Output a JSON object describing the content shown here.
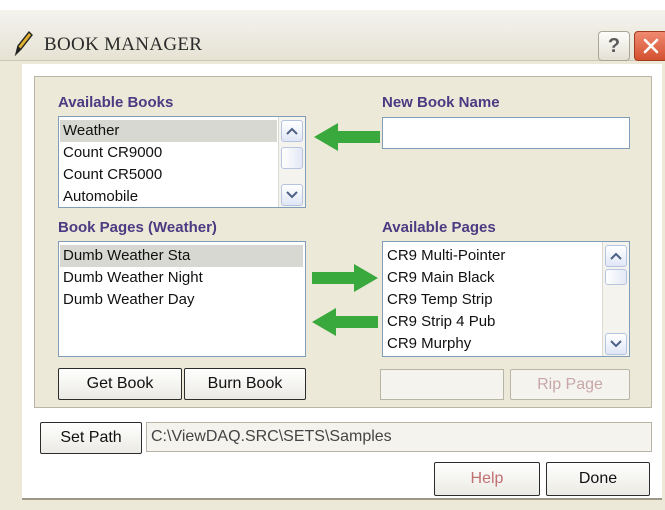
{
  "window": {
    "title": "BOOK MANAGER",
    "help_button": "?"
  },
  "available_books": {
    "label": "Available Books",
    "items": [
      "Weather",
      "Count CR9000",
      "Count CR5000",
      "Automobile"
    ],
    "selected": "Weather"
  },
  "new_book_name": {
    "label": "New Book Name",
    "value": ""
  },
  "book_pages": {
    "label": "Book Pages (Weather)",
    "items": [
      "Dumb Weather Sta",
      "Dumb Weather Night",
      "Dumb Weather Day"
    ],
    "selected": "Dumb Weather Sta"
  },
  "available_pages": {
    "label": "Available Pages",
    "items": [
      "CR9 Multi-Pointer",
      "CR9 Main Black",
      "CR9 Temp Strip",
      "CR9 Strip 4 Pub",
      "CR9 Murphy"
    ]
  },
  "buttons": {
    "get_book": "Get Book",
    "burn_book": "Burn Book",
    "rip_page": "Rip Page",
    "set_path": "Set Path",
    "help": "Help",
    "done": "Done"
  },
  "rip_page_input": {
    "value": ""
  },
  "path": {
    "value": "C:\\ViewDAQ.SRC\\SETS\\Samples"
  },
  "colors": {
    "label": "#4b3b82",
    "arrow": "#39a83d",
    "close": "#d4502f"
  },
  "icons": [
    "pencil-icon",
    "help-icon",
    "close-icon",
    "scroll-up-icon",
    "scroll-down-icon",
    "arrow-left-icon",
    "arrow-right-icon"
  ]
}
